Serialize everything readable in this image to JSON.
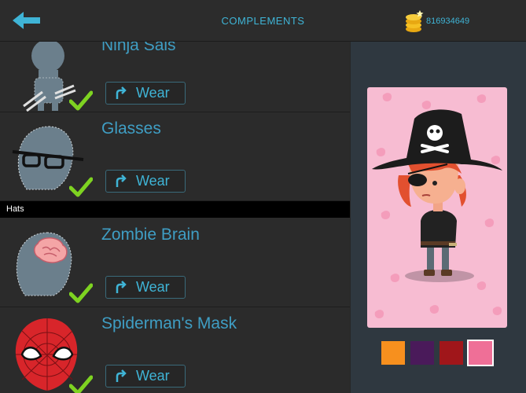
{
  "header": {
    "title": "COMPLEMENTS",
    "coins": "816934649"
  },
  "list": {
    "section_label": "Hats",
    "items": [
      {
        "name": "Ninja Sais",
        "button": "Wear"
      },
      {
        "name": "Glasses",
        "button": "Wear"
      },
      {
        "name": "Zombie Brain",
        "button": "Wear"
      },
      {
        "name": "Spiderman's Mask",
        "button": "Wear"
      }
    ]
  },
  "swatches": [
    "#f7901e",
    "#4a1a5a",
    "#a0161a",
    "#ef6f97"
  ],
  "colors": {
    "accent": "#3fb4d6",
    "check": "#7ed321"
  }
}
